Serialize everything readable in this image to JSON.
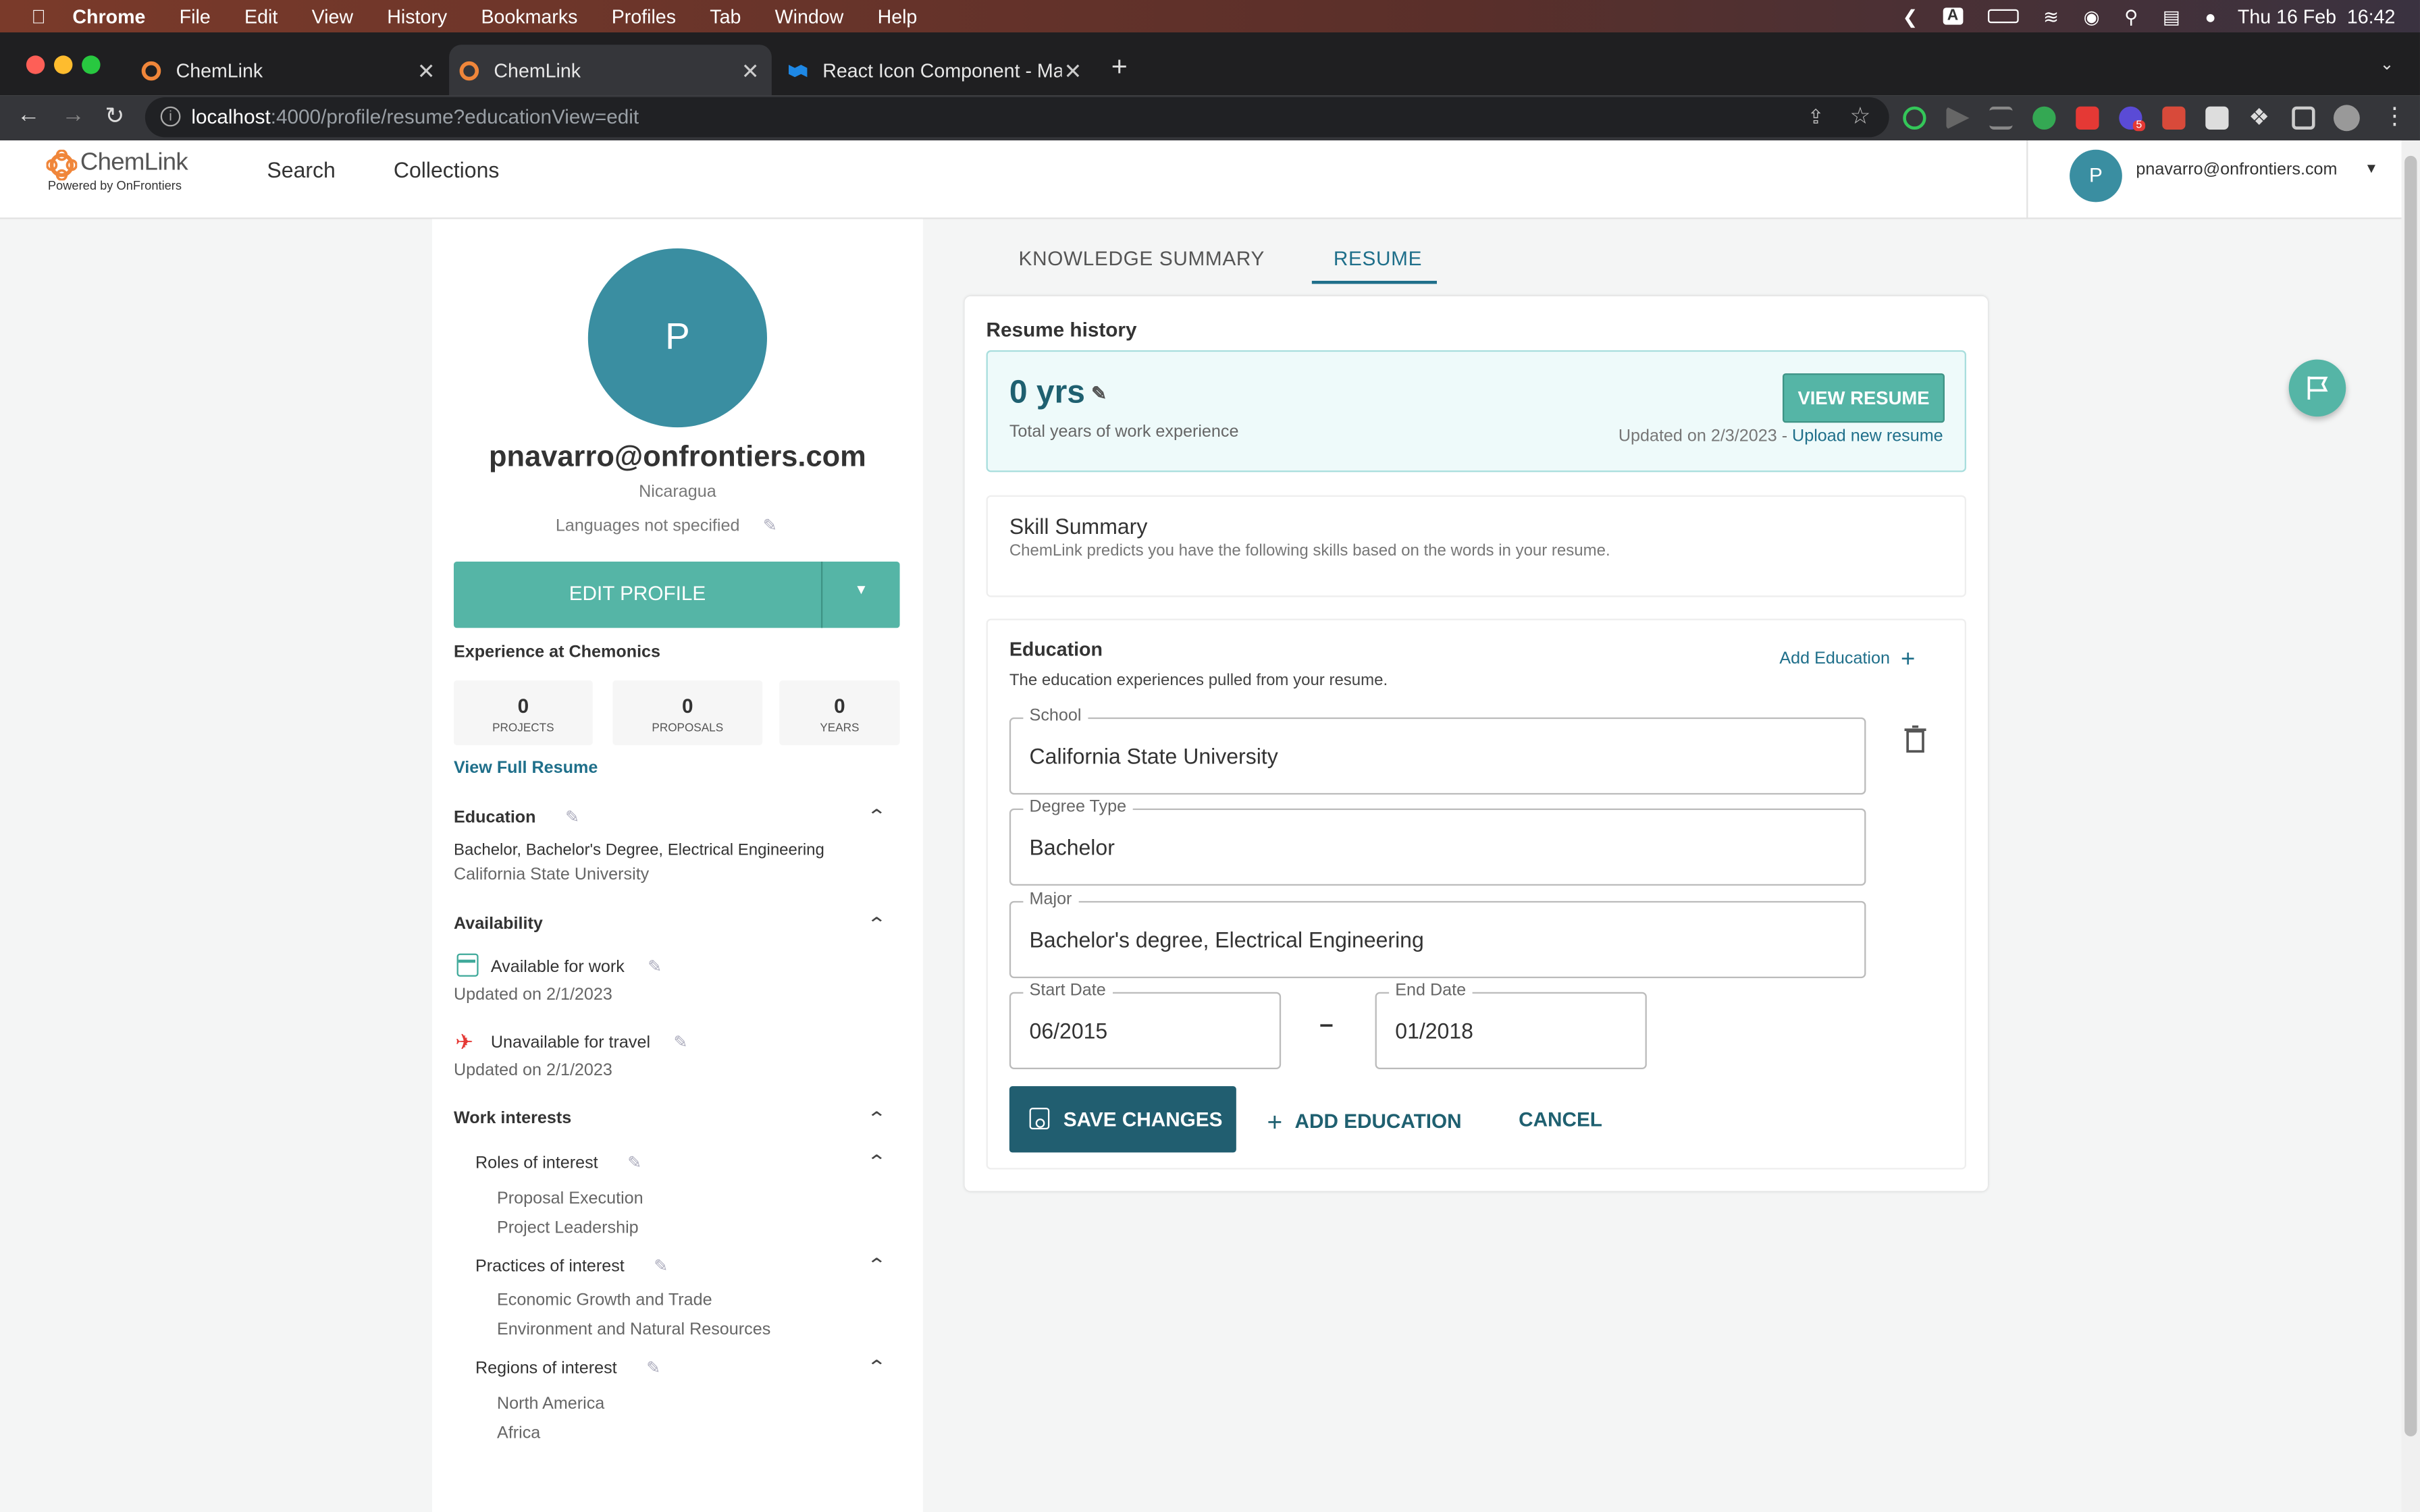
{
  "menubar": {
    "items": [
      "Chrome",
      "File",
      "Edit",
      "View",
      "History",
      "Bookmarks",
      "Profiles",
      "Tab",
      "Window",
      "Help"
    ],
    "datetime": "Thu 16 Feb  16:42",
    "input_indicator": "A"
  },
  "tabs": [
    {
      "title": "ChemLink"
    },
    {
      "title": "ChemLink"
    },
    {
      "title": "React Icon Component - Mater"
    }
  ],
  "address": {
    "host": "localhost",
    "path": ":4000/profile/resume?educationView=edit"
  },
  "extensions_badge": "5",
  "header": {
    "logo_name": "ChemLink",
    "logo_sub": "Powered by OnFrontiers",
    "nav": [
      "Search",
      "Collections"
    ],
    "user_initial": "P",
    "user_email": "pnavarro@onfrontiers.com"
  },
  "sidebar": {
    "avatar_initial": "P",
    "email": "pnavarro@onfrontiers.com",
    "country": "Nicaragua",
    "languages": "Languages not specified",
    "edit_profile": "EDIT PROFILE",
    "experience_title": "Experience at Chemonics",
    "stats": [
      {
        "value": "0",
        "label": "PROJECTS"
      },
      {
        "value": "0",
        "label": "PROPOSALS"
      },
      {
        "value": "0",
        "label": "YEARS"
      }
    ],
    "view_full_resume": "View Full Resume",
    "education": {
      "title": "Education",
      "degree": "Bachelor, Bachelor's Degree, Electrical Engineering",
      "school": "California State University"
    },
    "availability": {
      "title": "Availability",
      "work": "Available for work",
      "work_updated": "Updated on 2/1/2023",
      "travel": "Unavailable for travel",
      "travel_updated": "Updated on 2/1/2023"
    },
    "work_interests": {
      "title": "Work interests",
      "roles_title": "Roles of interest",
      "roles": [
        "Proposal Execution",
        "Project Leadership"
      ],
      "practices_title": "Practices of interest",
      "practices": [
        "Economic Growth and Trade",
        "Environment and Natural Resources"
      ],
      "regions_title": "Regions of interest",
      "regions": [
        "North America",
        "Africa"
      ]
    }
  },
  "main": {
    "tabs": [
      "KNOWLEDGE SUMMARY",
      "RESUME"
    ],
    "resume_history": "Resume history",
    "years": "0 yrs",
    "years_sub": "Total years of work experience",
    "view_resume": "VIEW RESUME",
    "updated_text": "Updated on 2/3/2023 - ",
    "upload_link": "Upload new resume",
    "skill_title": "Skill Summary",
    "skill_sub": "ChemLink predicts you have the following skills based on the words in your resume.",
    "education_title": "Education",
    "education_sub": "The education experiences pulled from your resume.",
    "add_education_link": "Add Education",
    "fields": {
      "school_label": "School",
      "school": "California State University",
      "degree_label": "Degree Type",
      "degree": "Bachelor",
      "major_label": "Major",
      "major": "Bachelor's degree, Electrical Engineering",
      "start_label": "Start Date",
      "start": "06/2015",
      "end_label": "End Date",
      "end": "01/2018"
    },
    "save_changes": "SAVE CHANGES",
    "add_education_btn": "ADD EDUCATION",
    "cancel": "CANCEL"
  },
  "colors": {
    "teal": "#55b5a6",
    "dark_teal": "#215e70",
    "avatar": "#3a8ea1"
  }
}
